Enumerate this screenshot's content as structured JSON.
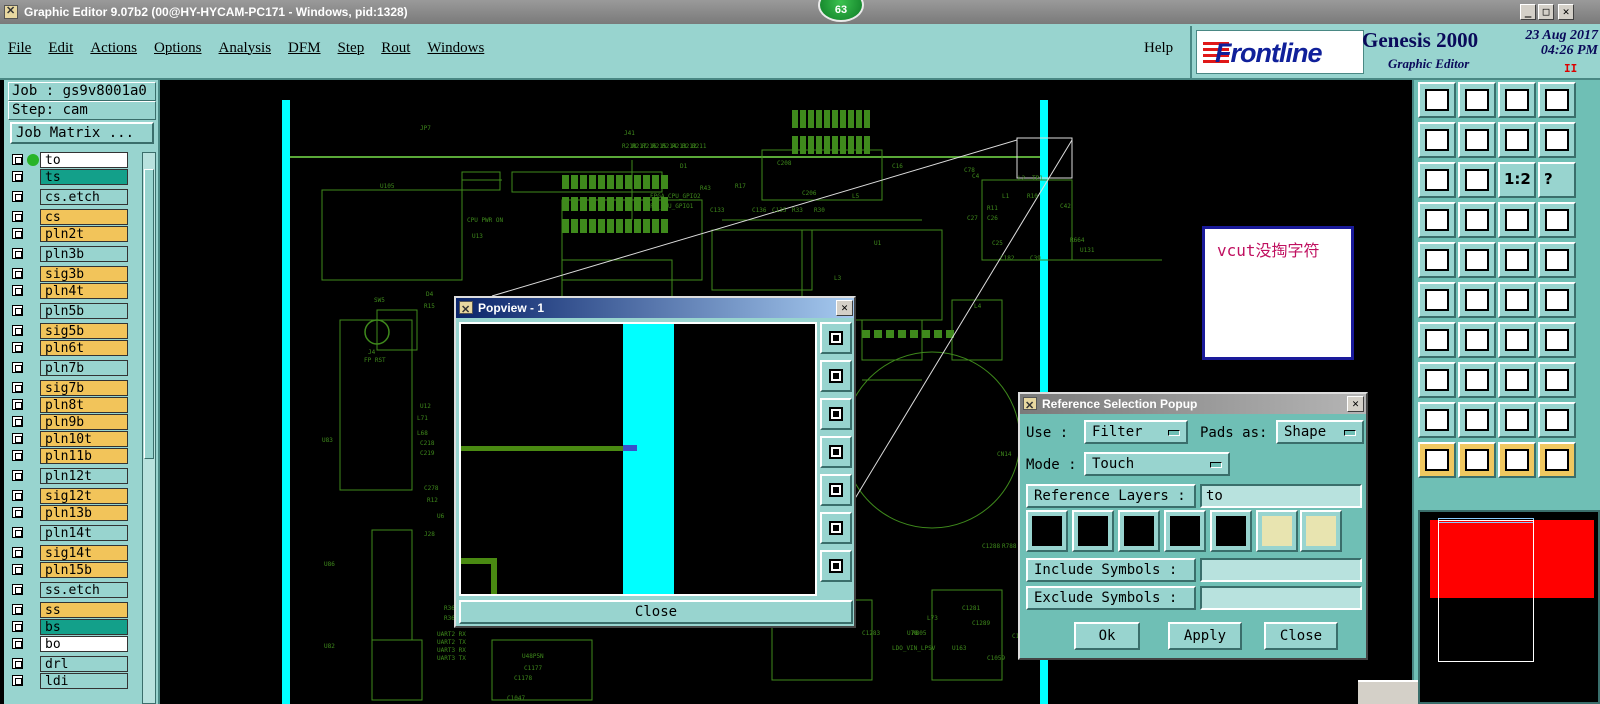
{
  "window": {
    "title": "Graphic Editor 9.07b2 (00@HY-HYCAM-PC171 - Windows, pid:1328)",
    "badge_count": "63",
    "minimize": "_",
    "maximize": "□",
    "close": "✕"
  },
  "menu": {
    "items": [
      "File",
      "Edit",
      "Actions",
      "Options",
      "Analysis",
      "DFM",
      "Step",
      "Rout",
      "Windows"
    ],
    "help": "Help"
  },
  "brand": {
    "logo_text": "Frontline",
    "product": "Genesis 2000",
    "subtitle": "Graphic Editor",
    "date": "23 Aug 2017",
    "time": "04:26 PM",
    "pause_mark": "II"
  },
  "job": {
    "job_label": "Job : gs9v8001a0",
    "step_label": "Step: cam",
    "job_matrix": "Job Matrix ..."
  },
  "layers": [
    {
      "name": "to",
      "color": "#ffffff",
      "active": true
    },
    {
      "name": "ts",
      "color": "#13a08a"
    },
    {
      "name": "cs.etch",
      "color": "#98d4cf",
      "gap": true
    },
    {
      "name": "cs",
      "color": "#f2c45a",
      "gap": true
    },
    {
      "name": "pln2t",
      "color": "#f2c45a"
    },
    {
      "name": "pln3b",
      "color": "#98d4cf",
      "gap": true
    },
    {
      "name": "sig3b",
      "color": "#f2c45a",
      "gap": true
    },
    {
      "name": "pln4t",
      "color": "#f2c45a"
    },
    {
      "name": "pln5b",
      "color": "#98d4cf",
      "gap": true
    },
    {
      "name": "sig5b",
      "color": "#f2c45a",
      "gap": true
    },
    {
      "name": "pln6t",
      "color": "#f2c45a"
    },
    {
      "name": "pln7b",
      "color": "#98d4cf",
      "gap": true
    },
    {
      "name": "sig7b",
      "color": "#f2c45a",
      "gap": true
    },
    {
      "name": "pln8t",
      "color": "#f2c45a"
    },
    {
      "name": "pln9b",
      "color": "#f2c45a"
    },
    {
      "name": "pln10t",
      "color": "#f2c45a"
    },
    {
      "name": "pln11b",
      "color": "#f2c45a"
    },
    {
      "name": "pln12t",
      "color": "#98d4cf",
      "gap": true
    },
    {
      "name": "sig12t",
      "color": "#f2c45a",
      "gap": true
    },
    {
      "name": "pln13b",
      "color": "#f2c45a"
    },
    {
      "name": "pln14t",
      "color": "#98d4cf",
      "gap": true
    },
    {
      "name": "sig14t",
      "color": "#f2c45a",
      "gap": true
    },
    {
      "name": "pln15b",
      "color": "#f2c45a"
    },
    {
      "name": "ss.etch",
      "color": "#98d4cf",
      "gap": true
    },
    {
      "name": "ss",
      "color": "#f2c45a",
      "gap": true
    },
    {
      "name": "bs",
      "color": "#13a08a"
    },
    {
      "name": "bo",
      "color": "#ffffff"
    },
    {
      "name": "drl",
      "color": "#98d4cf",
      "gap": true
    },
    {
      "name": "ldi",
      "color": "#98d4cf"
    }
  ],
  "canvas": {
    "note_text": "vcut没掏字符",
    "labels": [
      "JP7",
      "U105",
      "CPU PWR ON",
      "U13",
      "SW5",
      "FP RST",
      "U83",
      "U6",
      "U86",
      "U82",
      "J28",
      "J41",
      "D1",
      "R43",
      "R17",
      "C208",
      "C206",
      "FPGA_CPU_GPIO2",
      "FP_CPU_GPIO1",
      "C133",
      "C136",
      "C135",
      "R33",
      "R30",
      "U1",
      "L3",
      "L5",
      "C16",
      "C78",
      "C4",
      "L1",
      "L2",
      "TP1",
      "R10",
      "R11",
      "C26",
      "C27",
      "C25",
      "C182",
      "C39",
      "L4",
      "C42",
      "R664",
      "U131",
      "CN14",
      "RTC_BAT",
      "C1286",
      "C1288",
      "R788",
      "R820",
      "C1277",
      "U122",
      "C1278",
      "C1281",
      "C1039",
      "L73",
      "U78",
      "LDO_VIN_LPSV",
      "U163",
      "C1059",
      "R805",
      "C1289",
      "C1283",
      "C1047",
      "C1178",
      "C1177",
      "U48P5N",
      "UART2 RX",
      "UART2 TX",
      "UART3 RX",
      "UART3 TX",
      "R366",
      "R367",
      "C278",
      "R12",
      "U12",
      "L71",
      "L68",
      "C218",
      "C219",
      "J4",
      "D4",
      "R15",
      "R218",
      "R217",
      "R216",
      "R215",
      "R214",
      "R213",
      "R212",
      "R211",
      "R210"
    ]
  },
  "popview": {
    "title": "Popview - 1",
    "close_label": "Close",
    "close_x": "✕"
  },
  "refpopup": {
    "title": "Reference Selection Popup",
    "close_x": "✕",
    "use_label": "Use  :",
    "use_value": "Filter",
    "pads_label": "Pads as:",
    "pads_value": "Shape",
    "mode_label": "Mode :",
    "mode_value": "Touch",
    "ref_layers_label": "Reference Layers :",
    "ref_layers_value": "to",
    "include_label": "Include Symbols :",
    "include_value": "",
    "exclude_label": "Exclude Symbols :",
    "exclude_value": "",
    "ok": "Ok",
    "apply": "Apply",
    "close": "Close"
  },
  "right_tools": {
    "zoom_ratio": "1:2",
    "help": "?"
  }
}
